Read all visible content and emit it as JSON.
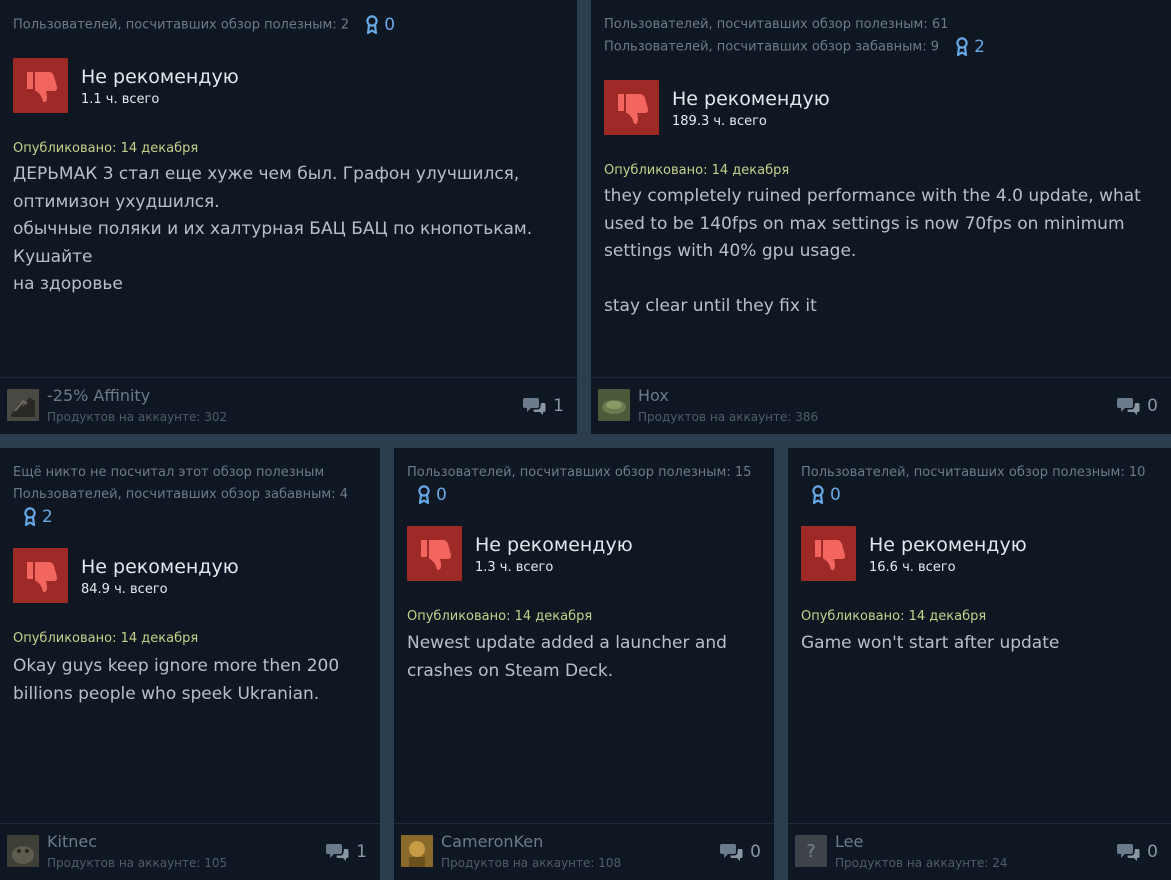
{
  "reviews": [
    {
      "helpful": "Пользователей, посчитавших обзор полезным: 2",
      "funny": "",
      "awards": "0",
      "verdict": "Не рекомендую",
      "hours": "1.1 ч. всего",
      "posted": "Опубликовано: 14 декабря",
      "text": [
        "ДЕРЬМАК 3 стал еще хуже чем был. Графон улучшился,",
        "оптимизон ухудшился.",
        "обычные поляки и их халтурная БАЦ БАЦ по кнопотькам. Кушайте",
        "на здоровье"
      ],
      "author": "-25% Affinity",
      "products": "Продуктов на аккаунте: 302",
      "comments": "1"
    },
    {
      "helpful": "Пользователей, посчитавших обзор полезным: 61",
      "funny": "Пользователей, посчитавших обзор забавным: 9",
      "awards": "2",
      "verdict": "Не рекомендую",
      "hours": "189.3 ч. всего",
      "posted": "Опубликовано: 14 декабря",
      "text": [
        "they completely ruined performance with the 4.0 update, what",
        "used to be 140fps on max settings is now 70fps on minimum",
        "settings with 40% gpu usage.",
        "",
        "stay clear until they fix it"
      ],
      "author": "Hox",
      "products": "Продуктов на аккаунте: 386",
      "comments": "0"
    },
    {
      "helpful": "Ещё никто не посчитал этот обзор полезным",
      "funny": "Пользователей, посчитавших обзор забавным: 4",
      "awards": "2",
      "verdict": "Не рекомендую",
      "hours": "84.9 ч. всего",
      "posted": "Опубликовано: 14 декабря",
      "text": [
        "Okay guys keep ignore more then 200",
        "billions people who speek Ukranian."
      ],
      "author": "Kitnec",
      "products": "Продуктов на аккаунте: 105",
      "comments": "1"
    },
    {
      "helpful": "Пользователей, посчитавших обзор полезным: 15",
      "funny": "",
      "awards": "0",
      "verdict": "Не рекомендую",
      "hours": "1.3 ч. всего",
      "posted": "Опубликовано: 14 декабря",
      "text": [
        "Newest update added a launcher and",
        "crashes on Steam Deck."
      ],
      "author": "CameronKen",
      "products": "Продуктов на аккаунте: 108",
      "comments": "0"
    },
    {
      "helpful": "Пользователей, посчитавших обзор полезным: 10",
      "funny": "",
      "awards": "0",
      "verdict": "Не рекомендую",
      "hours": "16.6 ч. всего",
      "posted": "Опубликовано: 14 декабря",
      "text": [
        "Game won't start after update"
      ],
      "author": "Lee",
      "products": "Продуктов на аккаунте: 24",
      "comments": "0"
    }
  ],
  "icons": {
    "award": "award-ribbon-icon",
    "thumb": "thumbs-down-icon",
    "comment": "comment-bubbles-icon",
    "avatar_placeholder": "?"
  },
  "colors": {
    "background": "#2b3e50",
    "card": "#0f1723",
    "thumb_bg": "#9e2a27",
    "posted": "#c5d08a",
    "award": "#67a9e6"
  }
}
